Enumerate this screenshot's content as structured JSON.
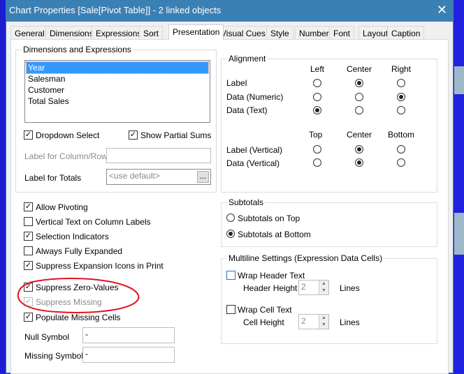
{
  "window": {
    "title": "Chart Properties [Sale[Pivot Table]] - 2 linked objects",
    "close": "✕"
  },
  "tabs": [
    "General",
    "Dimensions",
    "Expressions",
    "Sort",
    "Presentation",
    "Visual Cues",
    "Style",
    "Number",
    "Font",
    "Layout",
    "Caption"
  ],
  "active_tab": "Presentation",
  "dims": {
    "legend": "Dimensions and Expressions",
    "items": [
      "Year",
      "Salesman",
      "Customer",
      "Total Sales"
    ],
    "selected": "Year",
    "dropdown_select": {
      "label": "Dropdown Select",
      "checked": true
    },
    "show_partial_sums": {
      "label": "Show Partial Sums",
      "checked": true
    },
    "label_col_row": {
      "label": "Label for Column/Row",
      "value": ""
    },
    "label_totals": {
      "label": "Label for Totals",
      "placeholder": "<use default>",
      "button": "..."
    }
  },
  "alignment": {
    "legend": "Alignment",
    "h_cols": [
      "Left",
      "Center",
      "Right"
    ],
    "v_cols": [
      "Top",
      "Center",
      "Bottom"
    ],
    "rows": [
      {
        "label": "Label",
        "selected": "Center"
      },
      {
        "label": "Data (Numeric)",
        "selected": "Right"
      },
      {
        "label": "Data (Text)",
        "selected": "Left"
      }
    ],
    "vrows": [
      {
        "label": "Label (Vertical)",
        "selected": "Center"
      },
      {
        "label": "Data (Vertical)",
        "selected": "Center"
      }
    ]
  },
  "options": [
    {
      "label": "Allow Pivoting",
      "checked": true
    },
    {
      "label": "Vertical Text on Column Labels",
      "checked": false
    },
    {
      "label": "Selection Indicators",
      "checked": true
    },
    {
      "label": "Always Fully Expanded",
      "checked": false
    },
    {
      "label": "Suppress Expansion Icons in Print",
      "checked": true
    },
    {
      "label": "Suppress Zero-Values",
      "checked": true
    },
    {
      "label": "Suppress Missing",
      "checked": true,
      "disabled": true
    },
    {
      "label": "Populate Missing Cells",
      "checked": true
    }
  ],
  "null_symbol": {
    "label": "Null Symbol",
    "value": "-"
  },
  "missing_symbol": {
    "label": "Missing Symbol",
    "value": "-"
  },
  "subtotals": {
    "legend": "Subtotals",
    "options": [
      "Subtotals on Top",
      "Subtotals at Bottom"
    ],
    "selected": "Subtotals at Bottom"
  },
  "multiline": {
    "legend": "Multiline Settings (Expression Data Cells)",
    "wrap_header": {
      "label": "Wrap Header Text",
      "checked": false
    },
    "header_height": {
      "label": "Header Height",
      "value": "2",
      "unit": "Lines"
    },
    "wrap_cell": {
      "label": "Wrap Cell Text",
      "checked": false
    },
    "cell_height": {
      "label": "Cell Height",
      "value": "2",
      "unit": "Lines"
    }
  },
  "annotation": {
    "color": "#e0141e"
  }
}
